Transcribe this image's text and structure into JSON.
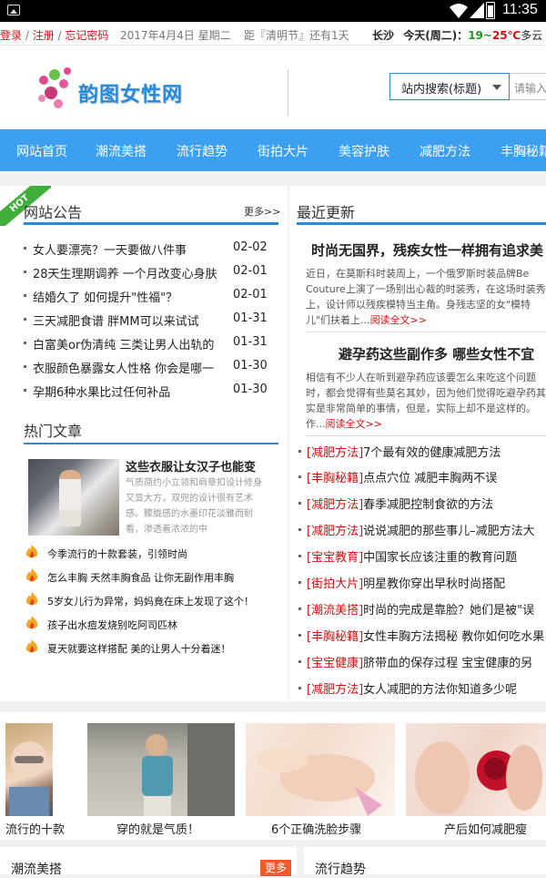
{
  "status_bar": {
    "time": "11:35"
  },
  "topbar": {
    "login": "登录",
    "sep1": " / ",
    "register": "注册",
    "sep2": " / ",
    "forgot": "忘记密码",
    "date": "2017年4月4日 星期二",
    "countdown": "距『清明节』还有1天",
    "city": "长沙",
    "today": "今天(周二)：",
    "temp_low": "19",
    "temp_sep": "~",
    "temp_high": "25℃",
    "weather": "多云",
    "more_arrow": "»"
  },
  "header": {
    "site_name": "韵图女性网",
    "search_select": "站内搜索(标题)",
    "search_placeholder": "请输入"
  },
  "nav": [
    "网站首页",
    "潮流美搭",
    "流行趋势",
    "街拍大片",
    "美容护肤",
    "减肥方法",
    "丰胸秘籍"
  ],
  "notice": {
    "badge": "HOT",
    "title": "网站公告",
    "more": "更多>>",
    "items": [
      {
        "title": "女人要漂亮？一天要做八件事",
        "date": "02-02"
      },
      {
        "title": "28天生理期调养 一个月改变心身肤",
        "date": "02-01"
      },
      {
        "title": "结婚久了 如何提升\"性福\"？",
        "date": "02-01"
      },
      {
        "title": "三天减肥食谱 胖MM可以来试试",
        "date": "01-31"
      },
      {
        "title": "白富美or伪清纯 三类让男人出轨的",
        "date": "01-31"
      },
      {
        "title": "衣服颜色暴露女人性格 你会是哪一",
        "date": "01-30"
      },
      {
        "title": "孕期6种水果比过任何补品",
        "date": "01-30"
      }
    ]
  },
  "hot": {
    "title": "热门文章",
    "featured": {
      "title": "这些衣服让女汉子也能变",
      "desc": "气质简约小立领和肩章扣设计修身又显大方，双兜的设计很有艺术感。朦胧感的水墨印花淡雅而耐看，渗透着浓浓的中"
    },
    "items": [
      "今季流行的十款套装，引领时尚",
      "怎么丰胸 天然丰胸食品 让你无副作用丰胸",
      "5岁女儿行为异常，妈妈竟在床上发现了这个！",
      "孩子出水痘发烧别吃阿司匹林",
      "夏天就要这样搭配 美的让男人十分着迷！"
    ]
  },
  "recent": {
    "title": "最近更新",
    "articles": [
      {
        "title": "时尚无国界，残疾女性一样拥有追求美",
        "body": "近日，在莫斯科时装周上，一个俄罗斯时装品牌Be Couture上演了一场别出心裁的时装秀，在这场时装秀上，设计师以残疾模特当主角。身残志坚的女\"模特儿\"们扶着上...",
        "read_more": "阅读全文>>"
      },
      {
        "title": "避孕药这些副作多 哪些女性不宜",
        "body": "相信有不少人在听到避孕药应该要怎么来吃这个问题时，都会觉得有些莫名其妙，因为他们觉得吃避孕药其实是非常简单的事情，但是，实际上却不是这样的。作...",
        "read_more": "阅读全文>>"
      }
    ],
    "list": [
      {
        "cat": "[减肥方法]",
        "title": "7个最有效的健康减肥方法"
      },
      {
        "cat": "[丰胸秘籍]",
        "title": "点点穴位 减肥丰胸两不误"
      },
      {
        "cat": "[减肥方法]",
        "title": "春季减肥控制食欲的方法"
      },
      {
        "cat": "[减肥方法]",
        "title": "说说减肥的那些事儿–减肥方法大"
      },
      {
        "cat": "[宝宝教育]",
        "title": "中国家长应该注重的教育问题"
      },
      {
        "cat": "[街拍大片]",
        "title": "明星教你穿出早秋时尚搭配"
      },
      {
        "cat": "[潮流美搭]",
        "title": "时尚的完成是靠脸？她们是被\"误"
      },
      {
        "cat": "[丰胸秘籍]",
        "title": "女性丰胸方法揭秘 教你如何吃水果"
      },
      {
        "cat": "[宝宝健康]",
        "title": "脐带血的保存过程 宝宝健康的另"
      },
      {
        "cat": "[减肥方法]",
        "title": "女人减肥的方法你知道多少呢"
      }
    ]
  },
  "gallery": [
    "流行的十款",
    "穿的就是气质！",
    "6个正确洗脸步骤",
    "产后如何减肥瘦"
  ],
  "footer": {
    "left_title": "潮流美搭",
    "left_more": "更多",
    "right_title": "流行趋势"
  },
  "colors": {
    "accent": "#2a8ad8",
    "nav": "#3c9ff0",
    "red": "#d01010",
    "green": "#1a9a1a",
    "hot_badge": "#3fae3a",
    "more_button": "#f25a2a"
  }
}
